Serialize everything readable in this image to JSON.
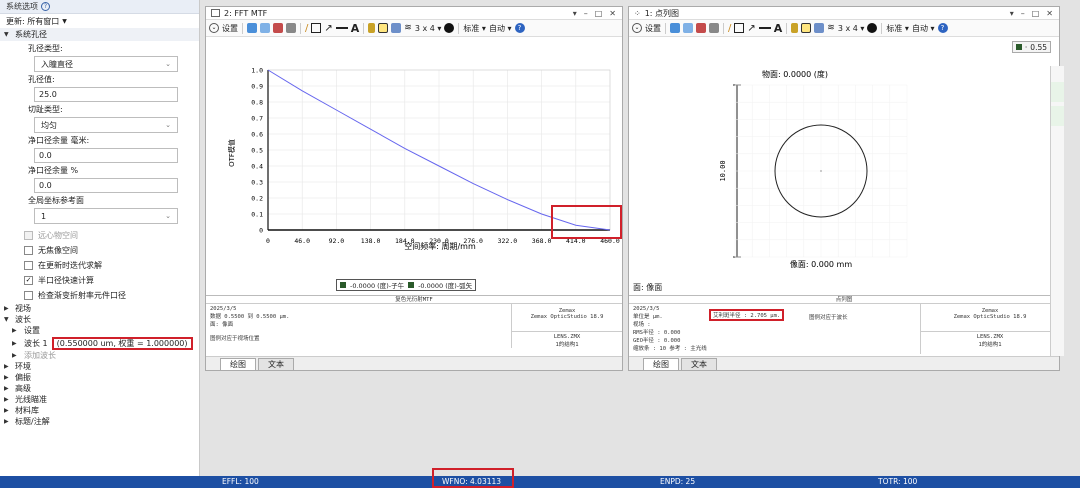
{
  "left": {
    "title": "系统选项",
    "update": "更新: 所有窗口",
    "section": "系统孔径",
    "aperture_type_label": "孔径类型:",
    "aperture_type_value": "入瞳直径",
    "aperture_value_label": "孔径值:",
    "aperture_value": "25.0",
    "apodization_label": "切趾类型:",
    "apodization_value": "均匀",
    "clear_margin_mm_label": "净口径余量 毫米:",
    "clear_margin_mm": "0.0",
    "clear_margin_pct_label": "净口径余量 %",
    "clear_margin_pct": "0.0",
    "global_ref_label": "全局坐标参考面",
    "global_ref_value": "1",
    "checks": [
      {
        "label": "远心物空间",
        "checked": false,
        "disabled": true
      },
      {
        "label": "无焦像空间",
        "checked": false,
        "disabled": false
      },
      {
        "label": "在更新时迭代求解",
        "checked": false,
        "disabled": false
      },
      {
        "label": "半口径快速计算",
        "checked": true,
        "disabled": false
      },
      {
        "label": "检查渐变折射率元件口径",
        "checked": false,
        "disabled": false
      }
    ],
    "tree": {
      "field": "视场",
      "wavelength": "波长",
      "settings": "设置",
      "wave1": "波长 1",
      "wave1_value": "(0.550000 um, 权重 = 1.000000)",
      "add_wave": "添加波长",
      "rest": [
        "环境",
        "偏振",
        "高级",
        "光线瞄准",
        "材料库",
        "标题/注解"
      ]
    }
  },
  "mtf": {
    "title": "2: FFT MTF",
    "settings": "设置",
    "layout": "3 x 4",
    "std": "标准",
    "auto": "自动",
    "ylabel": "OTF模值",
    "xlabel": "空间频率: 周期/mm",
    "yticks": [
      "1.0",
      "0.9",
      "0.8",
      "0.7",
      "0.6",
      "0.5",
      "0.4",
      "0.3",
      "0.2",
      "0.1",
      "0"
    ],
    "xticks": [
      "0",
      "46.0",
      "92.0",
      "138.0",
      "184.0",
      "230.0",
      "276.0",
      "322.0",
      "368.0",
      "414.0",
      "460.0"
    ],
    "legend1": "-0.0000 (度)-子午",
    "legend2": "-0.0000 (度)-弧矢",
    "report_head": "复色光衍射MTF",
    "report_lines": [
      "2025/3/5",
      "数据 0.5500 到 0.5500 μm.",
      "面: 像面",
      "",
      "图例对应于视场位置"
    ],
    "report_r1": [
      "Zemax",
      "Zemax OpticStudio 18.9"
    ],
    "report_r2": [
      "LENS.ZMX",
      "1的结构1"
    ],
    "tab_plot": "绘图",
    "tab_text": "文本"
  },
  "spot": {
    "title": "1: 点列图",
    "settings": "设置",
    "layout": "3 x 4",
    "std": "标准",
    "auto": "自动",
    "zoom": "0.55",
    "obj_label": "物面: 0.0000 (度)",
    "scale": "10.00",
    "img_label": "像面: 0.000 mm",
    "surface": "面: 像面",
    "report_head": "点列图",
    "report_lines": [
      "2025/3/5",
      "单位是 μm.",
      "视场       :",
      "RMS半径 :    0.000",
      "GEO半径 :    0.000",
      "缩放条  :     10    参考  : 主光线"
    ],
    "airy": "艾利斑半径 : 2.705 μm.",
    "legend_note": "图例对应于波长",
    "report_r1": [
      "Zemax",
      "Zemax OpticStudio 18.9"
    ],
    "report_r2": [
      "LENS.ZMX",
      "1的结构1"
    ],
    "tab_plot": "绘图",
    "tab_text": "文本"
  },
  "status": {
    "effl": "EFFL: 100",
    "wfno": "WFNO: 4.03113",
    "enpd": "ENPD: 25",
    "totr": "TOTR: 100"
  },
  "chart_data": [
    {
      "type": "line",
      "title": "",
      "xlabel": "空间频率: 周期/mm",
      "ylabel": "OTF模值",
      "xlim": [
        0,
        460
      ],
      "ylim": [
        0,
        1
      ],
      "series": [
        {
          "name": "-0.0000 (度)-子午",
          "x": [
            0,
            46,
            92,
            138,
            184,
            230,
            276,
            322,
            368,
            414,
            460
          ],
          "y": [
            1.0,
            0.87,
            0.75,
            0.63,
            0.51,
            0.4,
            0.29,
            0.19,
            0.1,
            0.03,
            0.0
          ]
        }
      ]
    }
  ]
}
